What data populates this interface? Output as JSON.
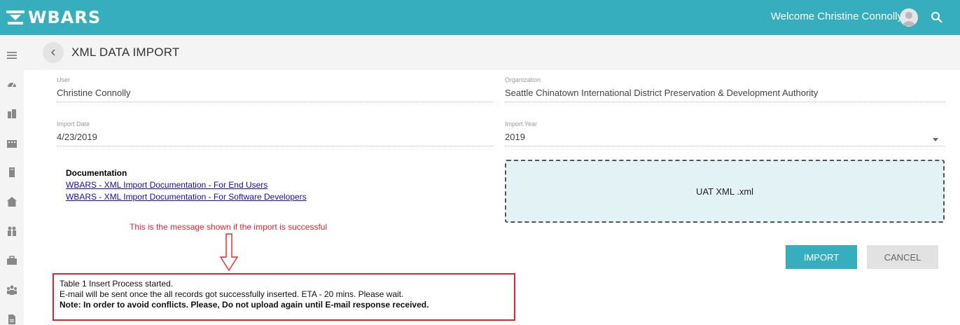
{
  "app": {
    "name": "WBARS",
    "brand_color": "#36aebe"
  },
  "topbar": {
    "welcome_text": "Welcome Christine Connolly",
    "avatar_icon": "user-avatar-icon",
    "search_icon": "search-icon"
  },
  "sidebar": {
    "items": [
      {
        "icon": "menu-icon"
      },
      {
        "icon": "dashboard-icon"
      },
      {
        "icon": "building-icon"
      },
      {
        "icon": "properties-icon"
      },
      {
        "icon": "tower-icon"
      },
      {
        "icon": "house-icon"
      },
      {
        "icon": "people-icon"
      },
      {
        "icon": "briefcase-icon"
      },
      {
        "icon": "group-icon"
      },
      {
        "icon": "document-icon"
      }
    ]
  },
  "page": {
    "title": "XML DATA IMPORT",
    "back_icon": "chevron-left-icon"
  },
  "form": {
    "user": {
      "label": "User",
      "value": "Christine Connolly"
    },
    "organization": {
      "label": "Organization",
      "value": "Seattle Chinatown International District Preservation & Development Authority"
    },
    "import_date": {
      "label": "Import Date",
      "value": "4/23/2019"
    },
    "import_year": {
      "label": "Import Year",
      "value": "2019"
    }
  },
  "documentation": {
    "title": "Documentation",
    "links": [
      "WBARS - XML Import Documentation - For End Users",
      "WBARS - XML Import Documentation - For Software Developers"
    ]
  },
  "dropzone": {
    "file_name": "UAT XML .xml"
  },
  "buttons": {
    "import": "IMPORT",
    "cancel": "CANCEL"
  },
  "annotation": {
    "text": "This is the message shown if the import is successful"
  },
  "message": {
    "line1": "Table 1 Insert Process started.",
    "line2": "E-mail will be sent once the all records got successfully inserted. ETA - 20 mins. Please wait.",
    "line3": "Note: In order to avoid conflicts. Please, Do not upload again until E-mail response received."
  }
}
